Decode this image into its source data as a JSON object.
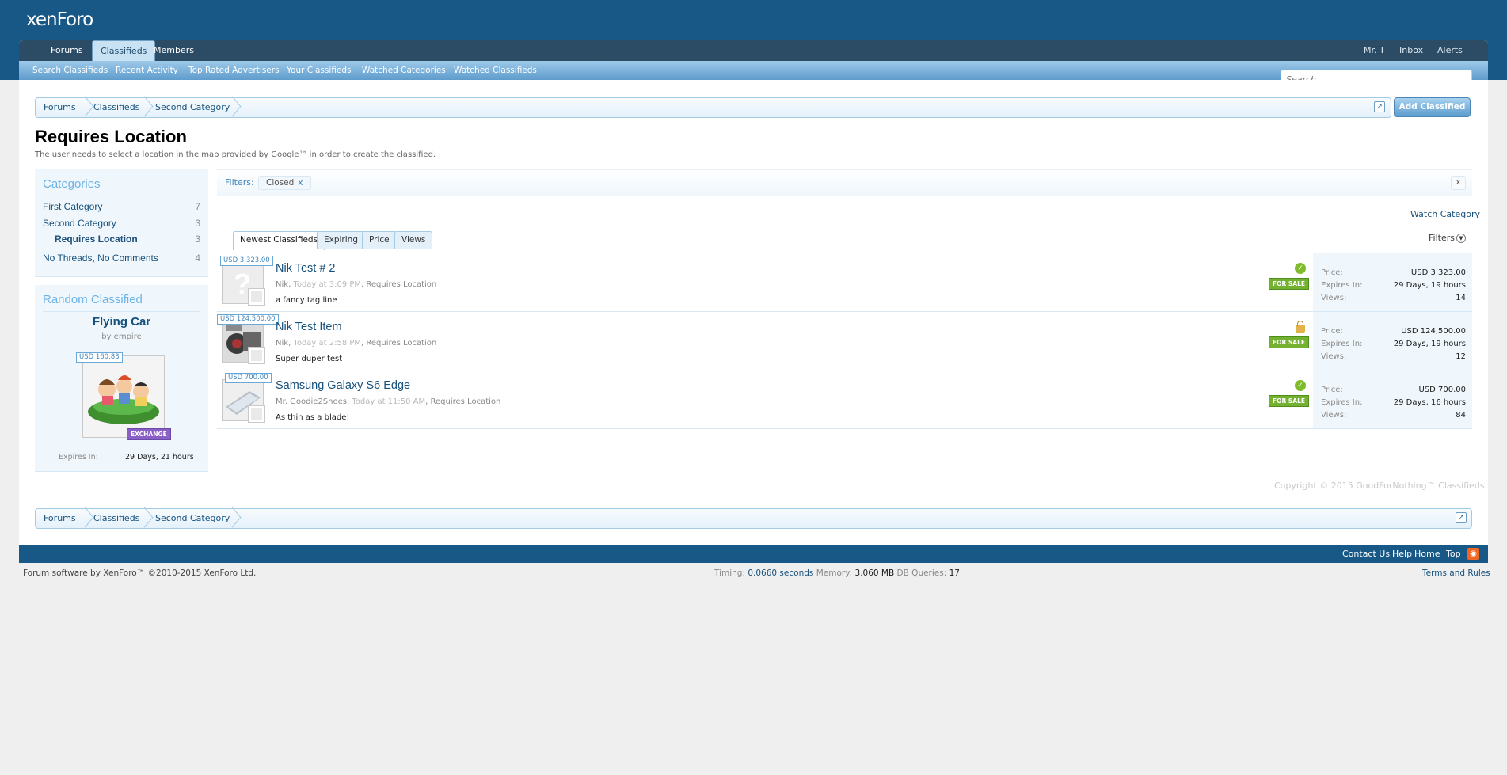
{
  "header": {
    "logo_main": "xen",
    "logo_bold": "Foro",
    "nav_tabs": [
      "Forums",
      "Classifieds",
      "Members"
    ],
    "nav_right": [
      "Mr. T",
      "Inbox",
      "Alerts"
    ],
    "subnav": [
      "Search Classifieds",
      "Recent Activity",
      "Top Rated Advertisers",
      "Your Classifieds",
      "Watched Categories",
      "Watched Classifieds"
    ],
    "search_placeholder": "Search..."
  },
  "breadcrumb": [
    "Forums",
    "Classifieds",
    "Second Category"
  ],
  "add_button": "Add Classified",
  "page": {
    "title": "Requires Location",
    "description": "The user needs to select a location in the map provided by Google™ in order to create the classified."
  },
  "sidebar": {
    "categories_title": "Categories",
    "categories": [
      {
        "label": "First Category",
        "count": "7"
      },
      {
        "label": "Second Category",
        "count": "3"
      },
      {
        "label": "Requires Location",
        "count": "3"
      },
      {
        "label": "No Threads, No Comments",
        "count": "4"
      }
    ],
    "random_title": "Random Classified",
    "random": {
      "name": "Flying Car",
      "by": "by empire",
      "price": "USD 160.83",
      "badge": "EXCHANGE",
      "expires_label": "Expires In:",
      "expires_value": "29 Days, 21 hours"
    }
  },
  "filters": {
    "label": "Filters:",
    "chip": "Closed",
    "chip_remove": "x",
    "close": "x"
  },
  "watch_category": "Watch Category",
  "tabs": [
    "Newest Classifieds",
    "Expiring",
    "Price",
    "Views"
  ],
  "filters_dropdown": "Filters",
  "listings": [
    {
      "price_tag": "USD 3,323.00",
      "title": "Nik Test # 2",
      "author": "Nik",
      "time": "Today at 3:09 PM",
      "category": "Requires Location",
      "tagline": "a fancy tag line",
      "status": "check",
      "sale": "FOR SALE",
      "price": "USD 3,323.00",
      "expires": "29 Days, 19 hours",
      "views": "14"
    },
    {
      "price_tag": "USD 124,500.00",
      "title": "Nik Test Item",
      "author": "Nik",
      "time": "Today at 2:58 PM",
      "category": "Requires Location",
      "tagline": "Super duper test",
      "status": "lock",
      "sale": "FOR SALE",
      "price": "USD 124,500.00",
      "expires": "29 Days, 19 hours",
      "views": "12"
    },
    {
      "price_tag": "USD 700.00",
      "title": "Samsung Galaxy S6 Edge",
      "author": "Mr. Goodie2Shoes",
      "time": "Today at 11:50 AM",
      "category": "Requires Location",
      "tagline": "As thin as a blade!",
      "status": "check",
      "sale": "FOR SALE",
      "price": "USD 700.00",
      "expires": "29 Days, 16 hours",
      "views": "84"
    }
  ],
  "stat_labels": {
    "price": "Price:",
    "expires": "Expires In:",
    "views": "Views:"
  },
  "copyright": "Copyright © 2015 GoodForNothing™ Classifieds.",
  "footer": {
    "links": [
      "Contact Us",
      "Help",
      "Home",
      "Top"
    ],
    "legal": "Forum software by XenForo™ ©2010-2015 XenForo Ltd.",
    "timing_label": "Timing:",
    "timing_value": "0.0660 seconds",
    "memory_label": "Memory:",
    "memory_value": "3.060 MB",
    "queries_label": "DB Queries:",
    "queries_value": "17",
    "terms": "Terms and Rules"
  },
  "colors": {
    "brand": "#185886",
    "accent": "#16507c",
    "sale": "#74b131",
    "exchange": "#8a5fc7"
  }
}
